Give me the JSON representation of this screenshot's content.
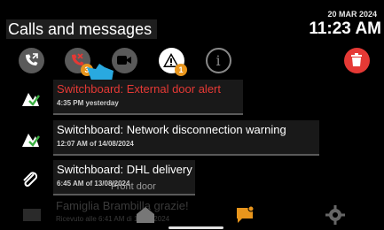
{
  "header": {
    "title": "Calls and messages",
    "date": "20 MAR 2024",
    "time": "11:23 AM"
  },
  "toolbar": {
    "items": [
      {
        "icon": "call-forward-icon"
      },
      {
        "icon": "missed-call-icon",
        "badge": "3"
      },
      {
        "icon": "video-icon"
      },
      {
        "icon": "alert-icon",
        "badge": "1"
      },
      {
        "icon": "info-icon"
      },
      {
        "icon": "trash-icon"
      }
    ]
  },
  "messages": [
    {
      "text": "Switchboard: External door alert",
      "when": "4:35 PM yesterday",
      "icon": "check-flag-icon",
      "color": "#e53935"
    },
    {
      "text": "Switchboard: Network disconnection warning",
      "when": "12:07 AM of 14/08/2024",
      "icon": "check-flag-icon",
      "color": "#ffffff"
    },
    {
      "text": "Switchboard: DHL delivery",
      "when": "6:45 AM of 13/08/2024",
      "icon": "paperclip-icon",
      "color": "#ffffff"
    }
  ],
  "ghost": {
    "line1": "Front door",
    "line2": "Famiglia Brambilla grazie!",
    "line3": "Ricevuto alle 6:41 AM di 17/07/2024"
  },
  "colors": {
    "accent_orange": "#e8951c",
    "trash_red": "#e53935",
    "alert_red": "#e53935",
    "finger_blue": "#29a9e0"
  }
}
